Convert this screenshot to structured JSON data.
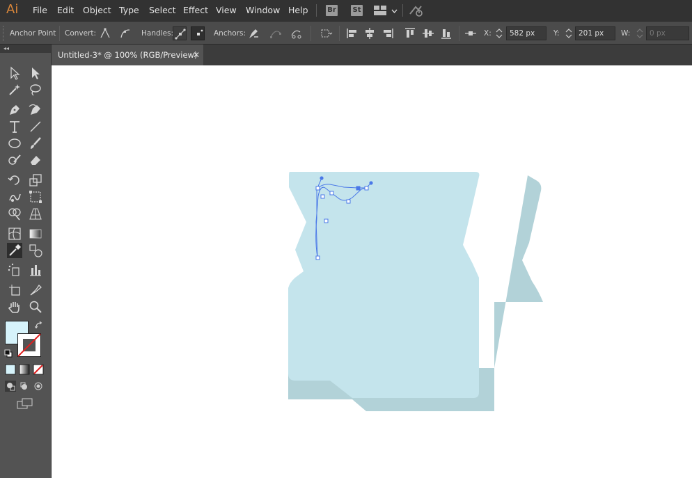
{
  "app": {
    "logo": "Ai"
  },
  "menubar": {
    "items": [
      "File",
      "Edit",
      "Object",
      "Type",
      "Select",
      "Effect",
      "View",
      "Window",
      "Help"
    ],
    "badges": [
      "Br",
      "St"
    ],
    "icons": [
      "workspace-layout-icon",
      "chevron-down-icon",
      "gpu-performance-icon"
    ]
  },
  "controlbar": {
    "tool_name": "Anchor Point",
    "convert_label": "Convert:",
    "handles_label": "Handles:",
    "anchors_label": "Anchors:",
    "x_label": "X:",
    "x_value": "582 px",
    "y_label": "Y:",
    "y_value": "201 px",
    "w_label": "W:",
    "w_value": "0 px"
  },
  "document": {
    "tab_title": "Untitled-3* @ 100% (RGB/Preview)",
    "close_glyph": "✕"
  },
  "toolbox": {
    "collapse_glyph": "◂◂",
    "fill_color": "#d6f3fb",
    "stroke": "none"
  },
  "colors": {
    "shape_front": "#c4e4ec",
    "shape_shadow": "#b2d2d8",
    "path_selection": "#4a78e8",
    "canvas": "#ffffff",
    "menubar": "#323232",
    "panel": "#535353"
  }
}
